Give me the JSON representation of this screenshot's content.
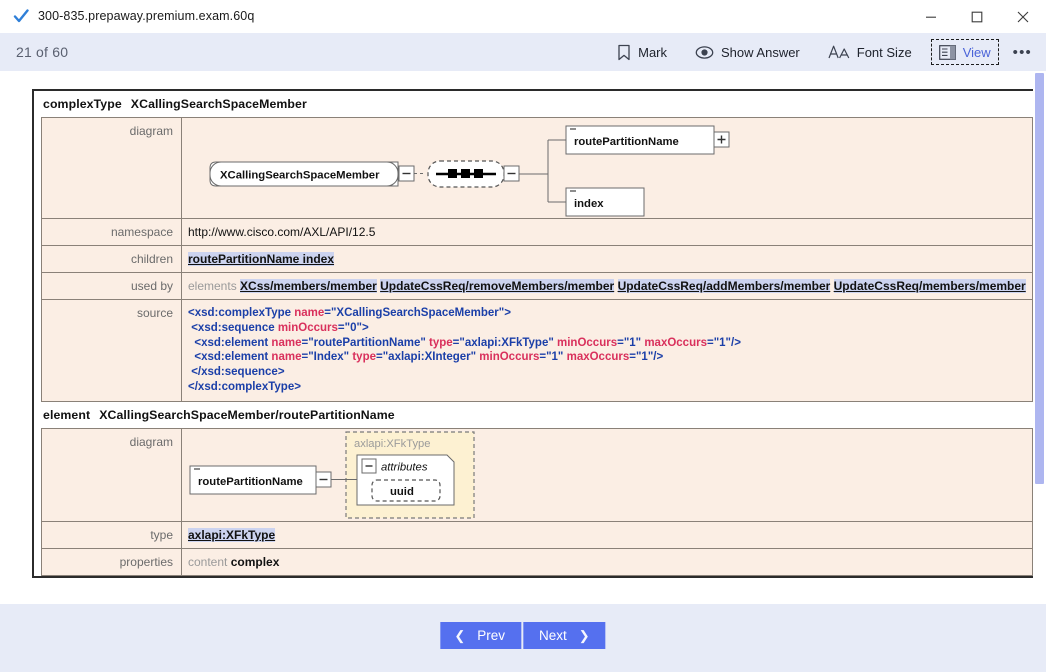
{
  "window": {
    "title": "300-835.prepaway.premium.exam.60q",
    "check_icon": "check-icon",
    "minimize_label": "Minimize",
    "maximize_label": "Maximize",
    "close_label": "Close"
  },
  "toolbar": {
    "counter": "21 of 60",
    "items": [
      {
        "label": "Mark",
        "icon": "bookmark-icon"
      },
      {
        "label": "Show Answer",
        "icon": "eye-icon"
      },
      {
        "label": "Font Size",
        "icon": "font-size-icon"
      },
      {
        "label": "View",
        "icon": "view-layout-icon"
      }
    ],
    "more_label": "•••"
  },
  "doc": {
    "sections": [
      {
        "kind": "complexType",
        "name": "XCallingSearchSpaceMember",
        "rows": [
          {
            "label": "diagram",
            "type": "diagram",
            "variant": "complextype"
          },
          {
            "label": "namespace",
            "type": "text",
            "value": "http://www.cisco.com/AXL/API/12.5"
          },
          {
            "label": "children",
            "type": "links",
            "links": [
              "routePartitionName index"
            ]
          },
          {
            "label": "used by",
            "type": "usedby",
            "prefix": "elements",
            "links": [
              "XCss/members/member",
              "UpdateCssReq/removeMembers/member",
              "UpdateCssReq/addMembers/member",
              "UpdateCssReq/members/member"
            ]
          },
          {
            "label": "source",
            "type": "source",
            "lines": [
              [
                {
                  "t": "pun",
                  "v": "<"
                },
                {
                  "t": "tag",
                  "v": "xsd:complexType"
                },
                {
                  "t": "pun",
                  "v": " "
                },
                {
                  "t": "attr",
                  "v": "name"
                },
                {
                  "t": "pun",
                  "v": "="
                },
                {
                  "t": "val",
                  "v": "\"XCallingSearchSpaceMember\""
                },
                {
                  "t": "pun",
                  "v": ">"
                }
              ],
              [
                {
                  "t": "pun",
                  "v": " <"
                },
                {
                  "t": "tag",
                  "v": "xsd:sequence"
                },
                {
                  "t": "pun",
                  "v": " "
                },
                {
                  "t": "attr",
                  "v": "minOccurs"
                },
                {
                  "t": "pun",
                  "v": "="
                },
                {
                  "t": "val",
                  "v": "\"0\""
                },
                {
                  "t": "pun",
                  "v": ">"
                }
              ],
              [
                {
                  "t": "pun",
                  "v": "  <"
                },
                {
                  "t": "tag",
                  "v": "xsd:element"
                },
                {
                  "t": "pun",
                  "v": " "
                },
                {
                  "t": "attr",
                  "v": "name"
                },
                {
                  "t": "pun",
                  "v": "="
                },
                {
                  "t": "val",
                  "v": "\"routePartitionName\""
                },
                {
                  "t": "pun",
                  "v": " "
                },
                {
                  "t": "attr",
                  "v": "type"
                },
                {
                  "t": "pun",
                  "v": "="
                },
                {
                  "t": "val",
                  "v": "\"axlapi:XFkType\""
                },
                {
                  "t": "pun",
                  "v": " "
                },
                {
                  "t": "attr",
                  "v": "minOccurs"
                },
                {
                  "t": "pun",
                  "v": "="
                },
                {
                  "t": "val",
                  "v": "\"1\""
                },
                {
                  "t": "pun",
                  "v": " "
                },
                {
                  "t": "attr",
                  "v": "maxOccurs"
                },
                {
                  "t": "pun",
                  "v": "="
                },
                {
                  "t": "val",
                  "v": "\"1\""
                },
                {
                  "t": "pun",
                  "v": "/>"
                }
              ],
              [
                {
                  "t": "pun",
                  "v": "  <"
                },
                {
                  "t": "tag",
                  "v": "xsd:element"
                },
                {
                  "t": "pun",
                  "v": " "
                },
                {
                  "t": "attr",
                  "v": "name"
                },
                {
                  "t": "pun",
                  "v": "="
                },
                {
                  "t": "val",
                  "v": "\"Index\""
                },
                {
                  "t": "pun",
                  "v": " "
                },
                {
                  "t": "attr",
                  "v": "type"
                },
                {
                  "t": "pun",
                  "v": "="
                },
                {
                  "t": "val",
                  "v": "\"axlapi:XInteger\""
                },
                {
                  "t": "pun",
                  "v": " "
                },
                {
                  "t": "attr",
                  "v": "minOccurs"
                },
                {
                  "t": "pun",
                  "v": "="
                },
                {
                  "t": "val",
                  "v": "\"1\""
                },
                {
                  "t": "pun",
                  "v": " "
                },
                {
                  "t": "attr",
                  "v": "maxOccurs"
                },
                {
                  "t": "pun",
                  "v": "="
                },
                {
                  "t": "val",
                  "v": "\"1\""
                },
                {
                  "t": "pun",
                  "v": "/>"
                }
              ],
              [
                {
                  "t": "pun",
                  "v": " </"
                },
                {
                  "t": "tag",
                  "v": "xsd:sequence"
                },
                {
                  "t": "pun",
                  "v": ">"
                }
              ],
              [
                {
                  "t": "pun",
                  "v": "</"
                },
                {
                  "t": "tag",
                  "v": "xsd:complexType"
                },
                {
                  "t": "pun",
                  "v": ">"
                }
              ]
            ]
          }
        ]
      },
      {
        "kind": "element",
        "name": "XCallingSearchSpaceMember/routePartitionName",
        "rows": [
          {
            "label": "diagram",
            "type": "diagram",
            "variant": "element"
          },
          {
            "label": "type",
            "type": "links",
            "links": [
              "axlapi:XFkType"
            ]
          },
          {
            "label": "properties",
            "type": "props",
            "key": "content",
            "value": "complex"
          }
        ]
      }
    ],
    "diagram1": {
      "root_label": "XCallingSearchSpaceMember",
      "child_labels": [
        "routePartitionName",
        "index"
      ],
      "expand_marker": "+",
      "collapse_marker": "−"
    },
    "diagram2": {
      "element_label": "routePartitionName",
      "type_label": "axlapi:XFkType",
      "attributes_label": "attributes",
      "attribute_items": [
        "uuid"
      ],
      "collapse_marker": "−"
    }
  },
  "nav": {
    "prev_label": "Prev",
    "next_label": "Next",
    "prev_chev": "❮",
    "next_chev": "❯"
  },
  "colors": {
    "toolbar_bg": "#e7ebf7",
    "nav_button": "#5570ef",
    "scrollbar": "#aeb6f0",
    "table_row": "#fbeee4",
    "type_box": "#fdf1d2",
    "tag": "#1b3fa8",
    "attr": "#d9305c",
    "link_hl": "#ccd3ef"
  }
}
